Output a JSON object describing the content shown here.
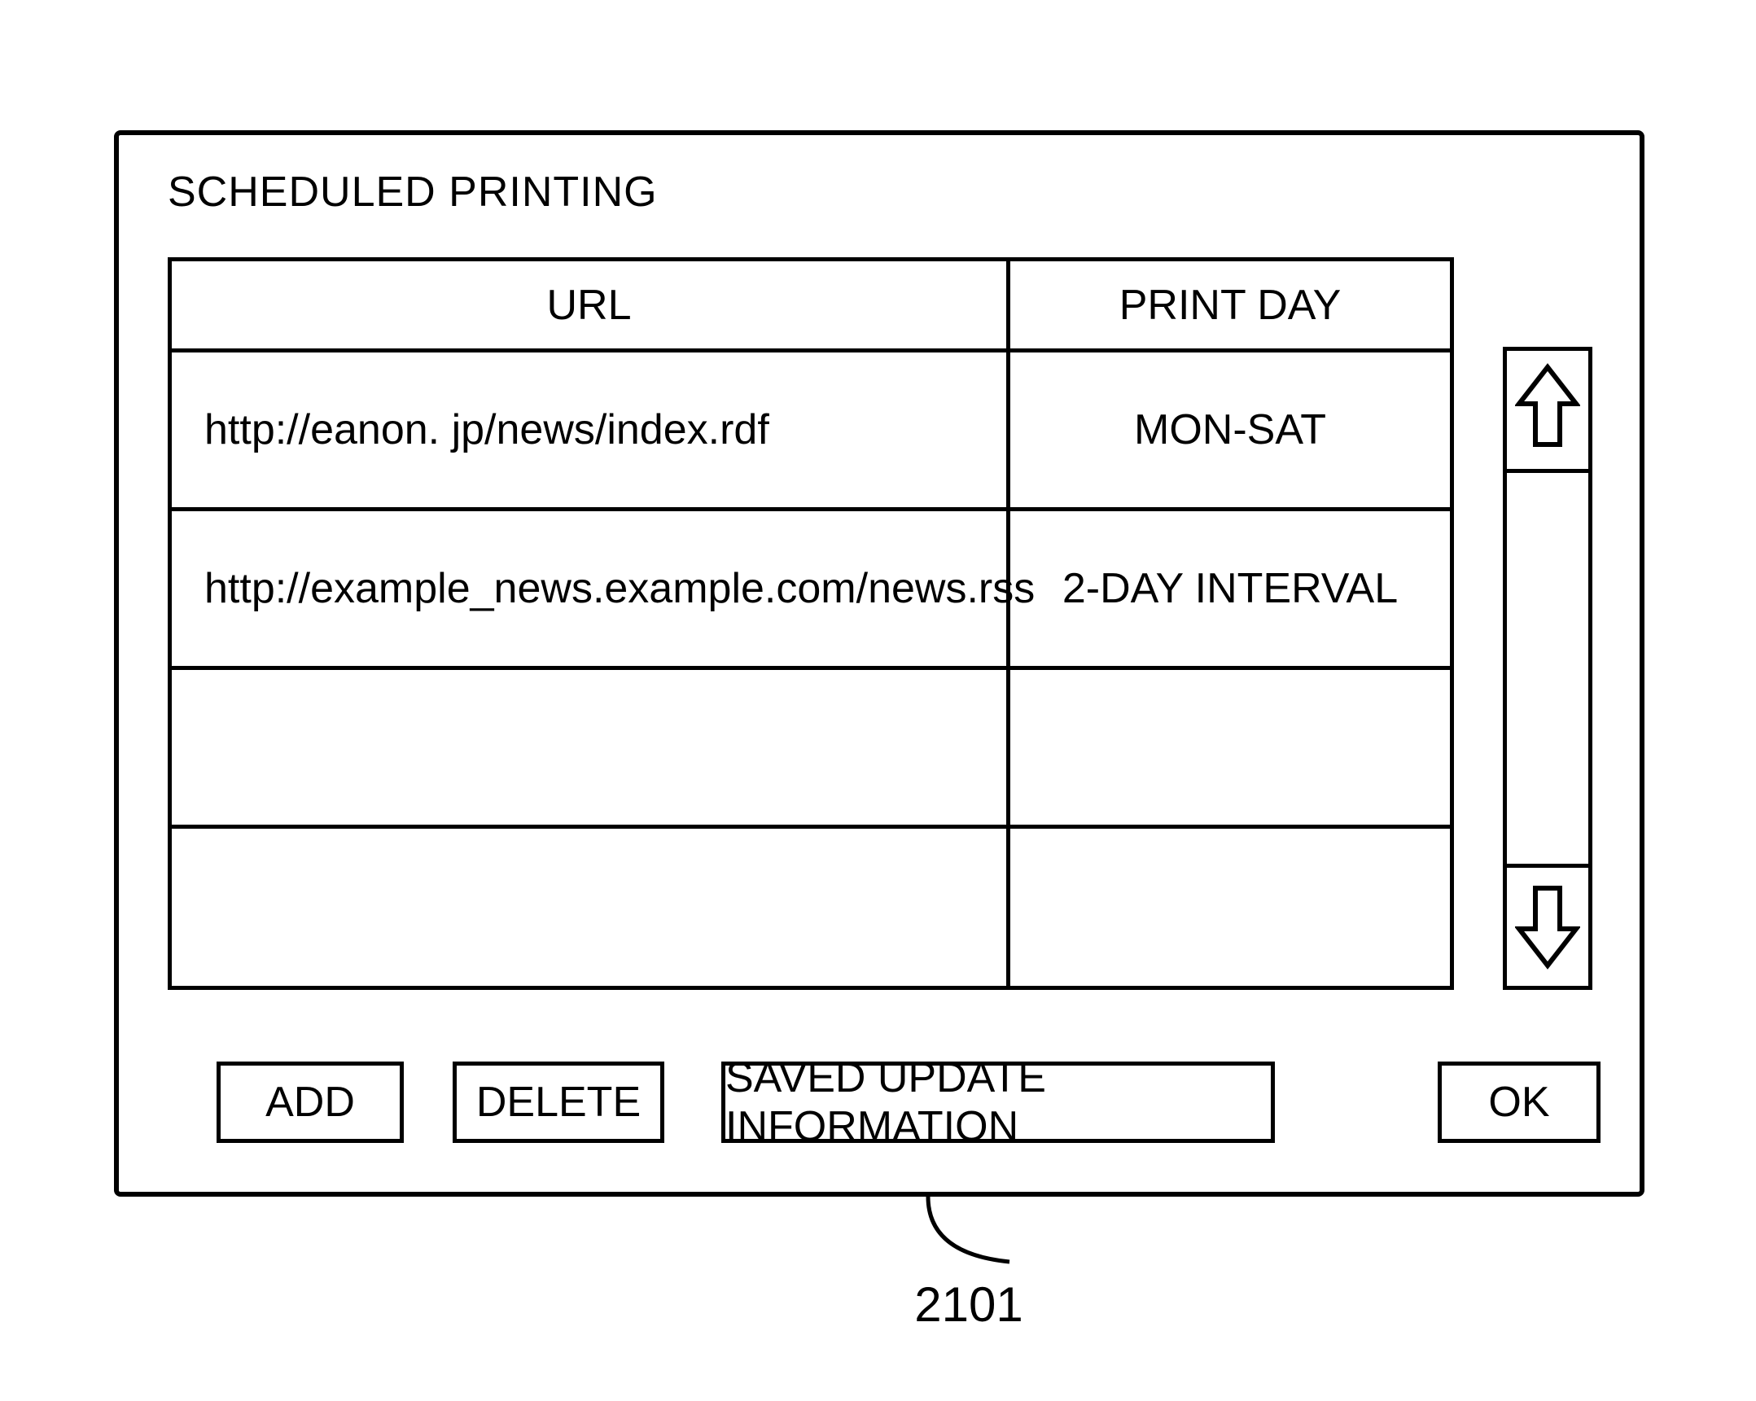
{
  "title": "SCHEDULED PRINTING",
  "table": {
    "headers": {
      "url": "URL",
      "print_day": "PRINT DAY"
    },
    "rows": [
      {
        "url": "http://eanon. jp/news/index.rdf",
        "print_day": "MON-SAT"
      },
      {
        "url": "http://example_news.example.com/news.rss",
        "print_day": "2-DAY INTERVAL"
      },
      {
        "url": "",
        "print_day": ""
      },
      {
        "url": "",
        "print_day": ""
      }
    ]
  },
  "buttons": {
    "add": "ADD",
    "delete": "DELETE",
    "saved_update": "SAVED UPDATE INFORMATION",
    "ok": "OK"
  },
  "callout_label": "2101"
}
